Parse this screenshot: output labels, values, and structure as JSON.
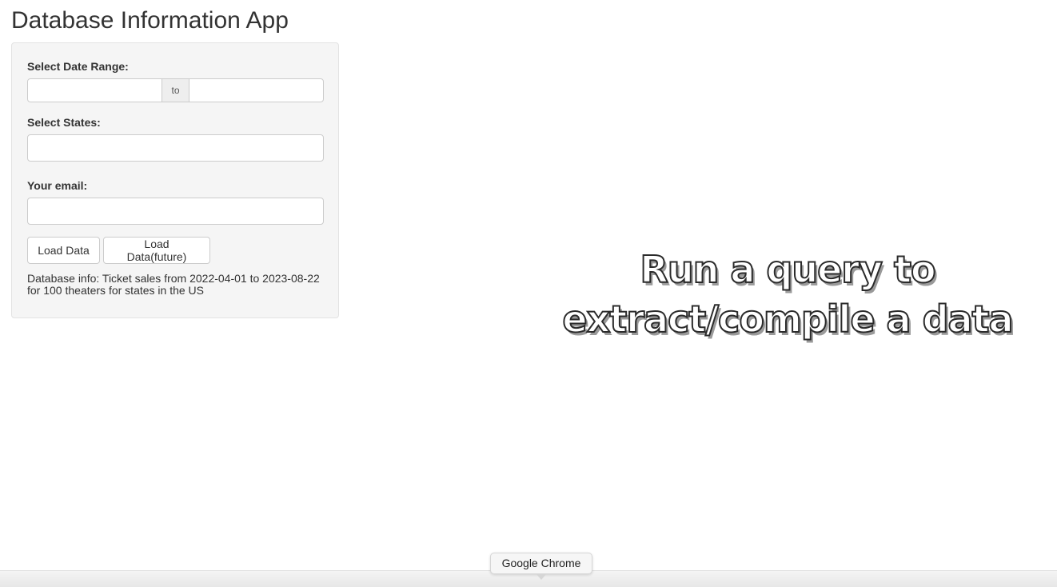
{
  "app": {
    "title": "Database Information App"
  },
  "sidebar": {
    "date_range": {
      "label": "Select Date Range:",
      "separator": "to",
      "start_value": "",
      "end_value": ""
    },
    "states": {
      "label": "Select States:",
      "value": ""
    },
    "email": {
      "label": "Your email:",
      "value": ""
    },
    "buttons": {
      "load_data": "Load Data",
      "load_data_future": "Load Data(future)"
    },
    "info_text": "Database info: Ticket sales from 2022-04-01 to 2023-08-22 for 100 theaters for states in the US"
  },
  "overlay": {
    "line1": "Run a query to",
    "line2": "extract/compile a data"
  },
  "dock": {
    "tooltip": "Google Chrome"
  }
}
